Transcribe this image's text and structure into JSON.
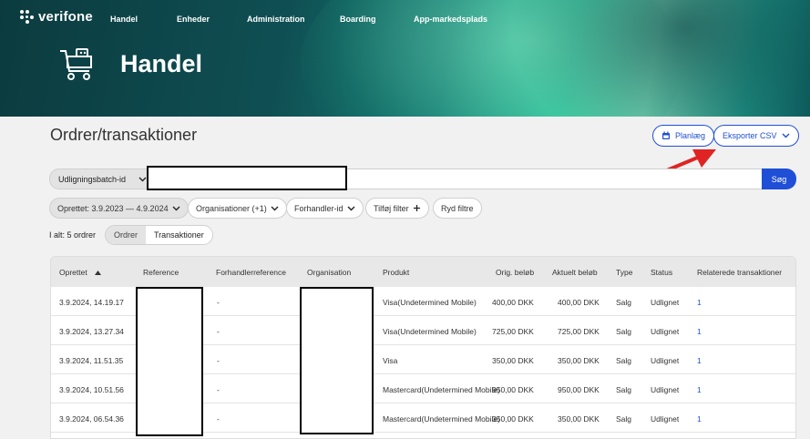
{
  "brand": {
    "name": "verifone"
  },
  "nav": [
    "Handel",
    "Enheder",
    "Administration",
    "Boarding",
    "App-markedsplads"
  ],
  "hero": {
    "title": "Handel",
    "icon": "shopping-cart-icon"
  },
  "page": {
    "title": "Ordrer/transaktioner"
  },
  "actions": {
    "schedule_label": "Planlæg",
    "export_label": "Eksporter CSV"
  },
  "search": {
    "field_select": "Udligningsbatch-id",
    "value": "",
    "button_label": "Søg"
  },
  "filters": {
    "date_range": "Oprettet: 3.9.2023 — 4.9.2024",
    "organisations": "Organisationer (+1)",
    "reseller": "Forhandler-id",
    "add": "Tilføj filter",
    "clear": "Ryd filtre"
  },
  "summary": {
    "total": "I alt: 5 ordrer"
  },
  "view_toggle": {
    "orders": "Ordrer",
    "transactions": "Transaktioner",
    "selected": "Transaktioner"
  },
  "table": {
    "columns": [
      "Oprettet",
      "Reference",
      "Forhandlerreference",
      "Organisation",
      "Produkt",
      "Orig. beløb",
      "Aktuelt beløb",
      "Type",
      "Status",
      "Relaterede transaktioner"
    ],
    "sort_column": "Oprettet",
    "rows": [
      {
        "created": "3.9.2024, 14.19.17",
        "reference": "",
        "reseller_ref": "-",
        "organisation": "",
        "product": "Visa(Undetermined Mobile)",
        "orig": "400,00 DKK",
        "current": "400,00 DKK",
        "type": "Salg",
        "status": "Udlignet",
        "related": "1"
      },
      {
        "created": "3.9.2024, 13.27.34",
        "reference": "",
        "reseller_ref": "-",
        "organisation": "",
        "product": "Visa(Undetermined Mobile)",
        "orig": "725,00 DKK",
        "current": "725,00 DKK",
        "type": "Salg",
        "status": "Udlignet",
        "related": "1"
      },
      {
        "created": "3.9.2024, 11.51.35",
        "reference": "",
        "reseller_ref": "-",
        "organisation": "",
        "product": "Visa",
        "orig": "350,00 DKK",
        "current": "350,00 DKK",
        "type": "Salg",
        "status": "Udlignet",
        "related": "1"
      },
      {
        "created": "3.9.2024, 10.51.56",
        "reference": "",
        "reseller_ref": "-",
        "organisation": "",
        "product": "Mastercard(Undetermined Mobile)",
        "orig": "950,00 DKK",
        "current": "950,00 DKK",
        "type": "Salg",
        "status": "Udlignet",
        "related": "1"
      },
      {
        "created": "3.9.2024, 06.54.36",
        "reference": "",
        "reseller_ref": "-",
        "organisation": "",
        "product": "Mastercard(Undetermined Mobile)",
        "orig": "350,00 DKK",
        "current": "350,00 DKK",
        "type": "Salg",
        "status": "Udlignet",
        "related": "1"
      }
    ]
  },
  "colors": {
    "accent": "#1f4fd6",
    "annotation_arrow": "#e02424"
  }
}
